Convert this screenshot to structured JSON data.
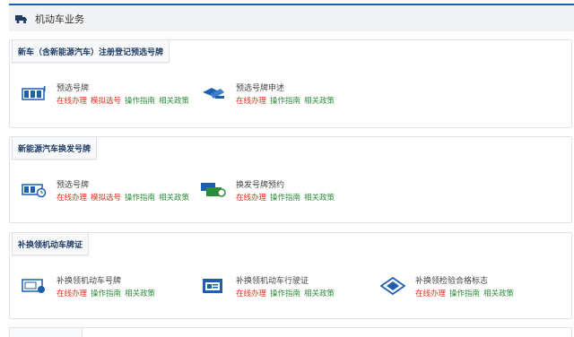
{
  "header": {
    "title": "机动车业务"
  },
  "sections": [
    {
      "title": "新车（含新能源汽车）注册登记预选号牌",
      "items": [
        {
          "name": "预选号牌",
          "icon": "plate-select-icon",
          "links": [
            {
              "label": "在线办理",
              "color": "red"
            },
            {
              "label": "模拟选号",
              "color": "red"
            },
            {
              "label": "操作指南",
              "color": "green"
            },
            {
              "label": "相关政策",
              "color": "green"
            }
          ]
        },
        {
          "name": "预选号牌申述",
          "icon": "plate-appeal-icon",
          "links": [
            {
              "label": "在线办理",
              "color": "red"
            },
            {
              "label": "操作指南",
              "color": "green"
            },
            {
              "label": "相关政策",
              "color": "green"
            }
          ]
        }
      ]
    },
    {
      "title": "新能源汽车换发号牌",
      "items": [
        {
          "name": "预选号牌",
          "icon": "plate-select-clock-icon",
          "links": [
            {
              "label": "在线办理",
              "color": "red"
            },
            {
              "label": "模拟选号",
              "color": "red"
            },
            {
              "label": "操作指南",
              "color": "green"
            },
            {
              "label": "相关政策",
              "color": "green"
            }
          ]
        },
        {
          "name": "换发号牌预约",
          "icon": "plate-reissue-icon",
          "links": [
            {
              "label": "在线办理",
              "color": "red"
            },
            {
              "label": "操作指南",
              "color": "green"
            },
            {
              "label": "相关政策",
              "color": "green"
            }
          ]
        }
      ]
    },
    {
      "title": "补换领机动车牌证",
      "items": [
        {
          "name": "补换领机动车号牌",
          "icon": "plate-replace-icon",
          "links": [
            {
              "label": "在线办理",
              "color": "red"
            },
            {
              "label": "操作指南",
              "color": "green"
            },
            {
              "label": "相关政策",
              "color": "green"
            }
          ]
        },
        {
          "name": "补换领机动车行驶证",
          "icon": "license-card-icon",
          "links": [
            {
              "label": "在线办理",
              "color": "red"
            },
            {
              "label": "操作指南",
              "color": "green"
            },
            {
              "label": "相关政策",
              "color": "green"
            }
          ]
        },
        {
          "name": "补换领检验合格标志",
          "icon": "inspection-badge-icon",
          "links": [
            {
              "label": "在线办理",
              "color": "red"
            },
            {
              "label": "操作指南",
              "color": "green"
            },
            {
              "label": "相关政策",
              "color": "green"
            }
          ]
        }
      ]
    }
  ],
  "colors": {
    "accent": "#1f5fae",
    "link_red": "#e0301e",
    "link_green": "#2e8b3a",
    "heading": "#1e3c64"
  },
  "header_icon": "truck-icon"
}
